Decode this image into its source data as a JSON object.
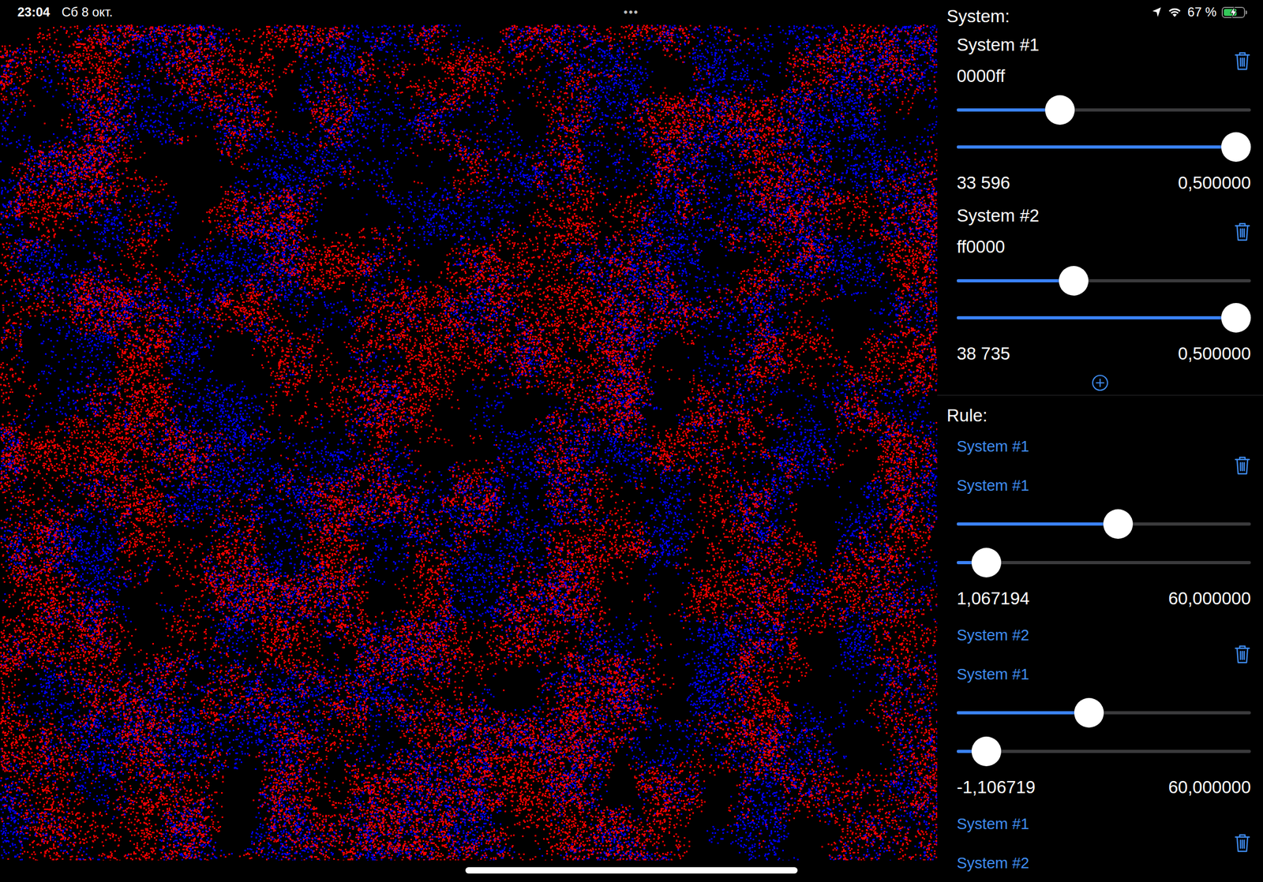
{
  "status_bar": {
    "time": "23:04",
    "date": "Сб 8 окт.",
    "multitasking": "•••",
    "battery": {
      "reading": "67 %",
      "level": 0.67,
      "charging": true
    }
  },
  "systems_header": "System:",
  "systems": [
    {
      "title": "System #1",
      "hex": "0000ff",
      "color": "#0000ff",
      "sliders": [
        {
          "level": 0.334
        },
        {
          "level": 1.0
        }
      ],
      "count": "33 596",
      "value": "0,500000"
    },
    {
      "title": "System #2",
      "hex": "ff0000",
      "color": "#ff0000",
      "sliders": [
        {
          "level": 0.386
        },
        {
          "level": 1.0
        }
      ],
      "count": "38 735",
      "value": "0,500000"
    }
  ],
  "rules_header": "Rule:",
  "rules": [
    {
      "from": "System #1",
      "to": "System #1",
      "sliders": [
        {
          "level": 0.553
        },
        {
          "level": 0.055
        }
      ],
      "force": "1,067194",
      "radius": "60,000000"
    },
    {
      "from": "System #2",
      "to": "System #1",
      "sliders": [
        {
          "level": 0.444
        },
        {
          "level": 0.055
        }
      ],
      "force": "-1,106719",
      "radius": "60,000000"
    },
    {
      "from": "System #1",
      "to": "System #2",
      "sliders": [],
      "force": "",
      "radius": ""
    }
  ]
}
